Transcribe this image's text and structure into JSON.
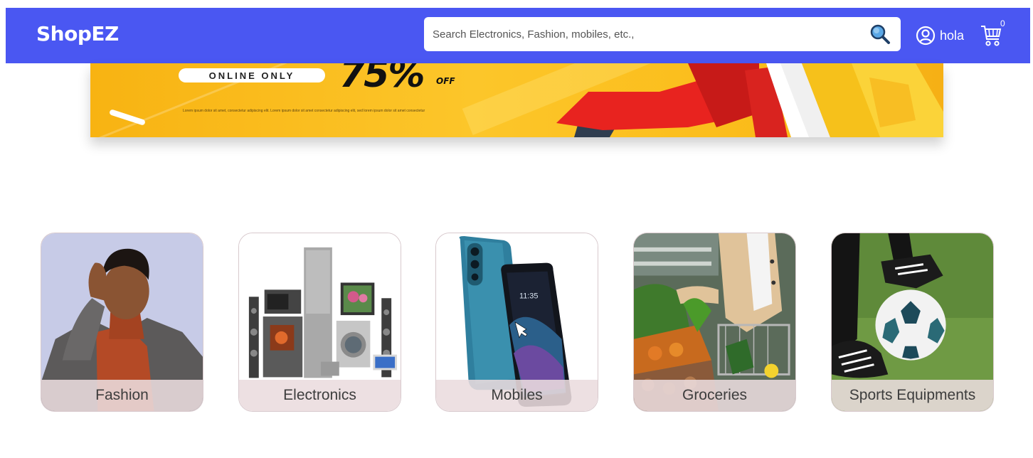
{
  "header": {
    "brand": "ShopEZ",
    "search_placeholder": "Search Electronics, Fashion, mobiles, etc.,",
    "search_icon": "search-icon",
    "user_label": "hola",
    "user_icon": "user-circle-icon",
    "cart_icon": "cart-icon",
    "cart_count": "0",
    "bg_color": "#4a57f2"
  },
  "banner": {
    "tag": "ONLINE ONLY",
    "discount": "75%",
    "discount_suffix": "OFF",
    "fine_print": "Lorem ipsum dolor sit amet, consectetur adipiscing elit. Lorem ipsum dolor sit amet consectetur adipiscing elit, sed lorem ipsum dolor sit amet consectetur",
    "bg_color": "#fcc62a"
  },
  "categories": [
    {
      "label": "Fashion"
    },
    {
      "label": "Electronics"
    },
    {
      "label": "Mobiles"
    },
    {
      "label": "Groceries"
    },
    {
      "label": "Sports Equipments"
    }
  ]
}
